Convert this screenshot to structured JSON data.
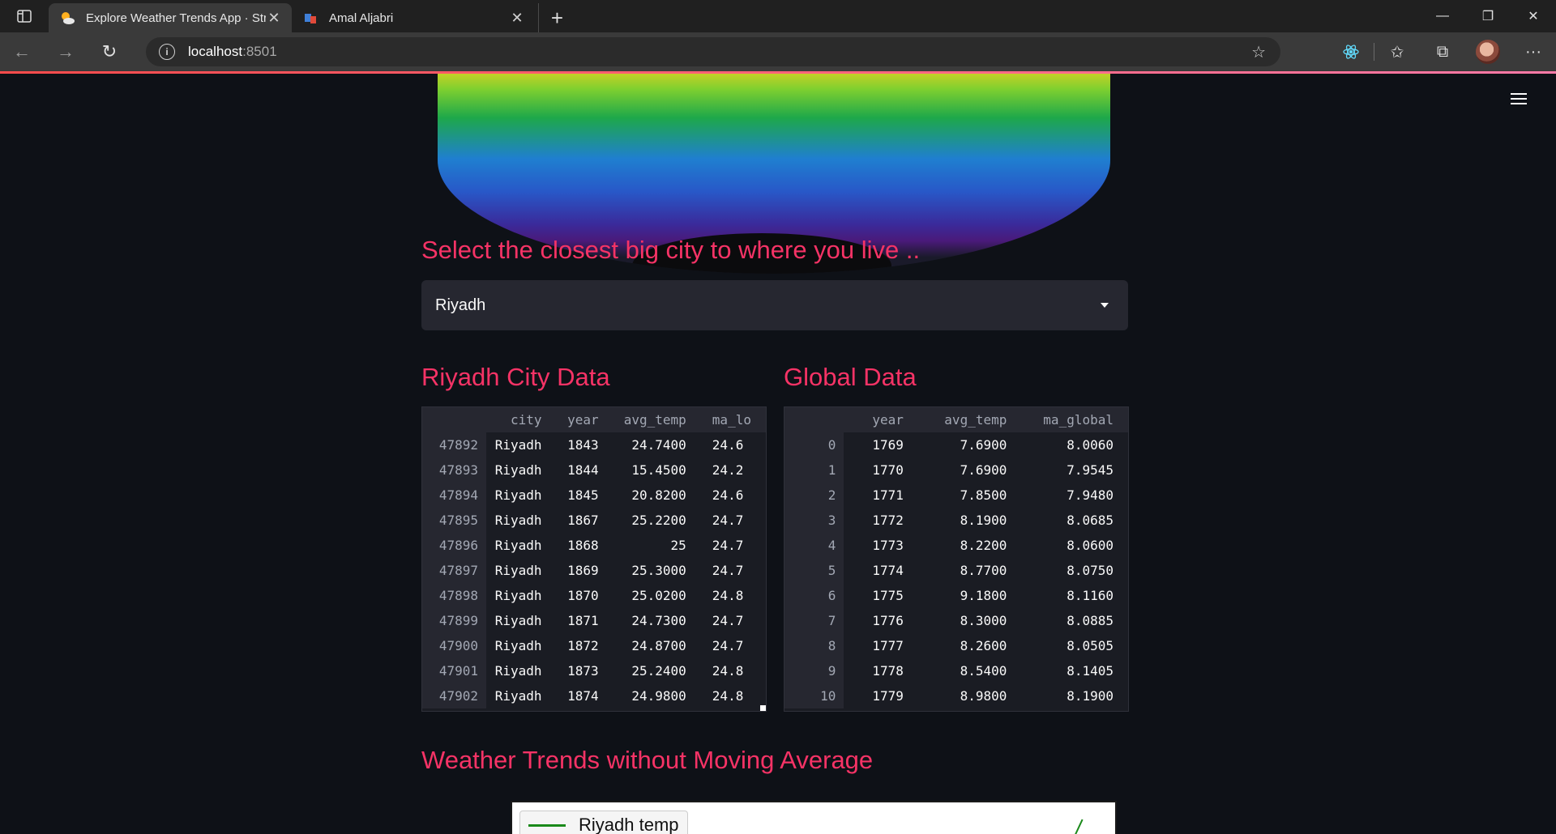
{
  "browser": {
    "tabs": [
      {
        "title": "Explore Weather Trends App · Str",
        "active": true
      },
      {
        "title": "Amal Aljabri",
        "active": false
      }
    ],
    "url_host": "localhost",
    "url_port": ":8501"
  },
  "app": {
    "select_heading": "Select the closest big city to where you live ..",
    "selected_city": "Riyadh",
    "city_table_heading": "Riyadh City Data",
    "global_table_heading": "Global Data",
    "chart_heading": "Weather Trends without Moving Average",
    "chart_legend": "Riyadh temp"
  },
  "city_table": {
    "columns": [
      "city",
      "year",
      "avg_temp",
      "ma_lo"
    ],
    "rows": [
      {
        "idx": "47892",
        "city": "Riyadh",
        "year": "1843",
        "avg_temp": "24.7400",
        "ma": "24.6"
      },
      {
        "idx": "47893",
        "city": "Riyadh",
        "year": "1844",
        "avg_temp": "15.4500",
        "ma": "24.2"
      },
      {
        "idx": "47894",
        "city": "Riyadh",
        "year": "1845",
        "avg_temp": "20.8200",
        "ma": "24.6"
      },
      {
        "idx": "47895",
        "city": "Riyadh",
        "year": "1867",
        "avg_temp": "25.2200",
        "ma": "24.7"
      },
      {
        "idx": "47896",
        "city": "Riyadh",
        "year": "1868",
        "avg_temp": "25",
        "ma": "24.7"
      },
      {
        "idx": "47897",
        "city": "Riyadh",
        "year": "1869",
        "avg_temp": "25.3000",
        "ma": "24.7"
      },
      {
        "idx": "47898",
        "city": "Riyadh",
        "year": "1870",
        "avg_temp": "25.0200",
        "ma": "24.8"
      },
      {
        "idx": "47899",
        "city": "Riyadh",
        "year": "1871",
        "avg_temp": "24.7300",
        "ma": "24.7"
      },
      {
        "idx": "47900",
        "city": "Riyadh",
        "year": "1872",
        "avg_temp": "24.8700",
        "ma": "24.7"
      },
      {
        "idx": "47901",
        "city": "Riyadh",
        "year": "1873",
        "avg_temp": "25.2400",
        "ma": "24.8"
      },
      {
        "idx": "47902",
        "city": "Riyadh",
        "year": "1874",
        "avg_temp": "24.9800",
        "ma": "24.8"
      }
    ]
  },
  "global_table": {
    "columns": [
      "year",
      "avg_temp",
      "ma_global"
    ],
    "rows": [
      {
        "idx": "0",
        "year": "1769",
        "avg_temp": "7.6900",
        "ma": "8.0060"
      },
      {
        "idx": "1",
        "year": "1770",
        "avg_temp": "7.6900",
        "ma": "7.9545"
      },
      {
        "idx": "2",
        "year": "1771",
        "avg_temp": "7.8500",
        "ma": "7.9480"
      },
      {
        "idx": "3",
        "year": "1772",
        "avg_temp": "8.1900",
        "ma": "8.0685"
      },
      {
        "idx": "4",
        "year": "1773",
        "avg_temp": "8.2200",
        "ma": "8.0600"
      },
      {
        "idx": "5",
        "year": "1774",
        "avg_temp": "8.7700",
        "ma": "8.0750"
      },
      {
        "idx": "6",
        "year": "1775",
        "avg_temp": "9.1800",
        "ma": "8.1160"
      },
      {
        "idx": "7",
        "year": "1776",
        "avg_temp": "8.3000",
        "ma": "8.0885"
      },
      {
        "idx": "8",
        "year": "1777",
        "avg_temp": "8.2600",
        "ma": "8.0505"
      },
      {
        "idx": "9",
        "year": "1778",
        "avg_temp": "8.5400",
        "ma": "8.1405"
      },
      {
        "idx": "10",
        "year": "1779",
        "avg_temp": "8.9800",
        "ma": "8.1900"
      }
    ]
  },
  "colors": {
    "accent": "#f63366",
    "background": "#0e1117",
    "select_bg": "#262730",
    "legend_line": "#1b8a1b"
  }
}
